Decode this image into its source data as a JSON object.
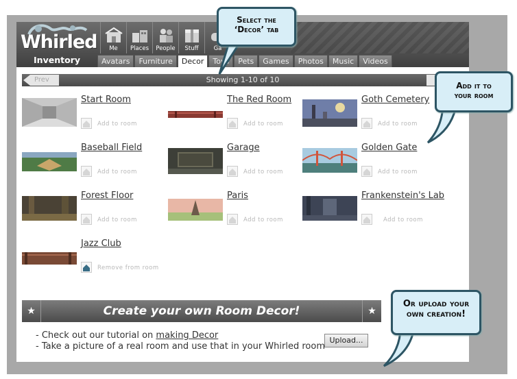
{
  "app": {
    "logo": "Whirled",
    "section_title": "Inventory"
  },
  "nav_icons": [
    {
      "label": "Me",
      "icon": "me-icon"
    },
    {
      "label": "Places",
      "icon": "places-icon"
    },
    {
      "label": "People",
      "icon": "people-icon"
    },
    {
      "label": "Stuff",
      "icon": "stuff-icon"
    },
    {
      "label": "Ga",
      "icon": "games-icon"
    }
  ],
  "tabs": [
    "Avatars",
    "Furniture",
    "Decor",
    "Toys",
    "Pets",
    "Games",
    "Photos",
    "Music",
    "Videos"
  ],
  "active_tab": "Decor",
  "pager": {
    "prev": "Prev",
    "next": "Next",
    "showing": "Showing 1-10 of 10"
  },
  "items": [
    {
      "name": "Start Room",
      "action": "Add to room"
    },
    {
      "name": "The Red Room",
      "action": "Add to room"
    },
    {
      "name": "Goth Cemetery",
      "action": "Add to room"
    },
    {
      "name": "Baseball Field",
      "action": "Add to room"
    },
    {
      "name": "Garage",
      "action": "Add to room"
    },
    {
      "name": "Golden Gate",
      "action": "Add to room"
    },
    {
      "name": "Forest Floor",
      "action": "Add to room"
    },
    {
      "name": "Paris",
      "action": "Add to room"
    },
    {
      "name": "Frankenstein's Lab",
      "action": "Add to room"
    },
    {
      "name": "Jazz Club",
      "action": "Remove from room"
    }
  ],
  "create": {
    "banner": "Create your own Room Decor!",
    "line1_prefix": "- Check out our tutorial on ",
    "line1_link": "making Decor",
    "line2": "- Take a picture of a real room and use that in your Whirled room",
    "upload_label": "Upload..."
  },
  "callouts": {
    "select_tab": [
      "Select the",
      "‘Decor’ tab"
    ],
    "add_room": [
      "Add it to",
      "your room"
    ],
    "upload": [
      "Or upload your",
      "own creation!"
    ]
  },
  "colors": {
    "callout_bg": "#d8eef7",
    "callout_border": "#2d5564",
    "bar_dark": "#4b4b4b"
  }
}
